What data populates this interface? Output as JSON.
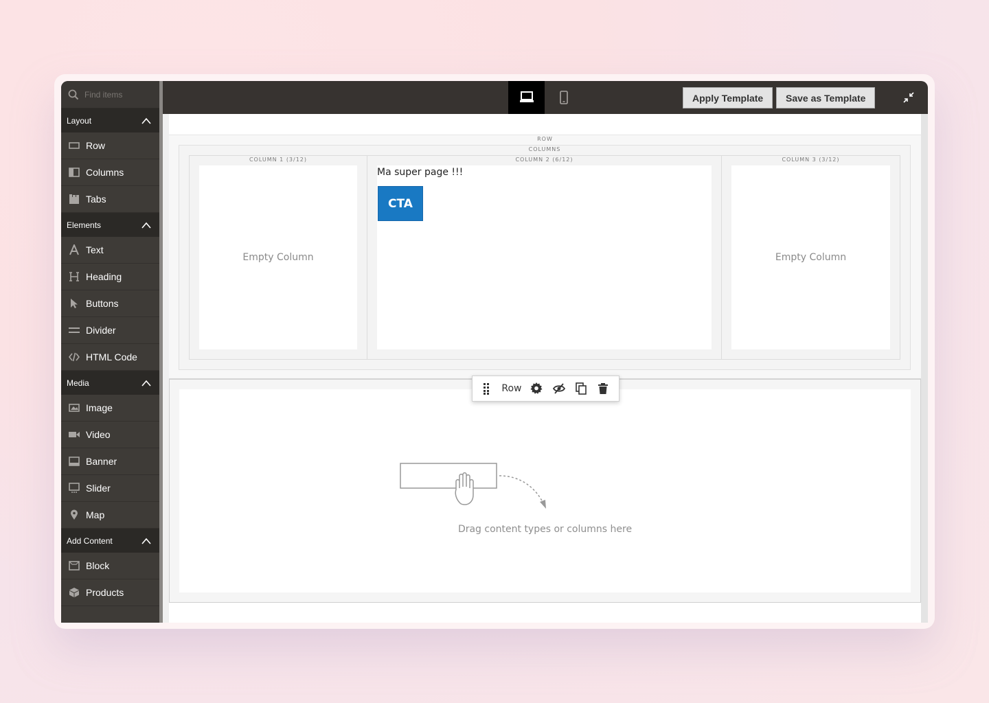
{
  "search": {
    "placeholder": "Find items"
  },
  "sidebar": {
    "groups": [
      {
        "title": "Layout",
        "items": [
          {
            "label": "Row",
            "icon": "row-icon"
          },
          {
            "label": "Columns",
            "icon": "columns-icon"
          },
          {
            "label": "Tabs",
            "icon": "tabs-icon"
          }
        ]
      },
      {
        "title": "Elements",
        "items": [
          {
            "label": "Text",
            "icon": "text-icon"
          },
          {
            "label": "Heading",
            "icon": "heading-icon"
          },
          {
            "label": "Buttons",
            "icon": "pointer-icon"
          },
          {
            "label": "Divider",
            "icon": "divider-icon"
          },
          {
            "label": "HTML Code",
            "icon": "code-icon"
          }
        ]
      },
      {
        "title": "Media",
        "items": [
          {
            "label": "Image",
            "icon": "image-icon"
          },
          {
            "label": "Video",
            "icon": "video-icon"
          },
          {
            "label": "Banner",
            "icon": "banner-icon"
          },
          {
            "label": "Slider",
            "icon": "slider-icon"
          },
          {
            "label": "Map",
            "icon": "map-pin-icon"
          }
        ]
      },
      {
        "title": "Add Content",
        "items": [
          {
            "label": "Block",
            "icon": "block-icon"
          },
          {
            "label": "Products",
            "icon": "products-icon"
          }
        ]
      }
    ]
  },
  "toolbar": {
    "apply_template": "Apply Template",
    "save_template": "Save as Template",
    "devices": [
      "desktop-icon",
      "mobile-icon"
    ]
  },
  "stage": {
    "row_label": "ROW",
    "columns_label": "COLUMNS",
    "col1_label": "COLUMN 1 (3/12)",
    "col2_label": "COLUMN 2 (6/12)",
    "col3_label": "COLUMN 3 (3/12)",
    "empty_column": "Empty Column",
    "col2_text": "Ma super page !!!",
    "cta_label": "CTA",
    "row_bar_label": "Row",
    "drag_hint": "Drag content types or columns here"
  },
  "colors": {
    "sidebar_bg": "#3e3b37",
    "toolbar_bg": "#373330",
    "cta_blue": "#1979c3"
  }
}
